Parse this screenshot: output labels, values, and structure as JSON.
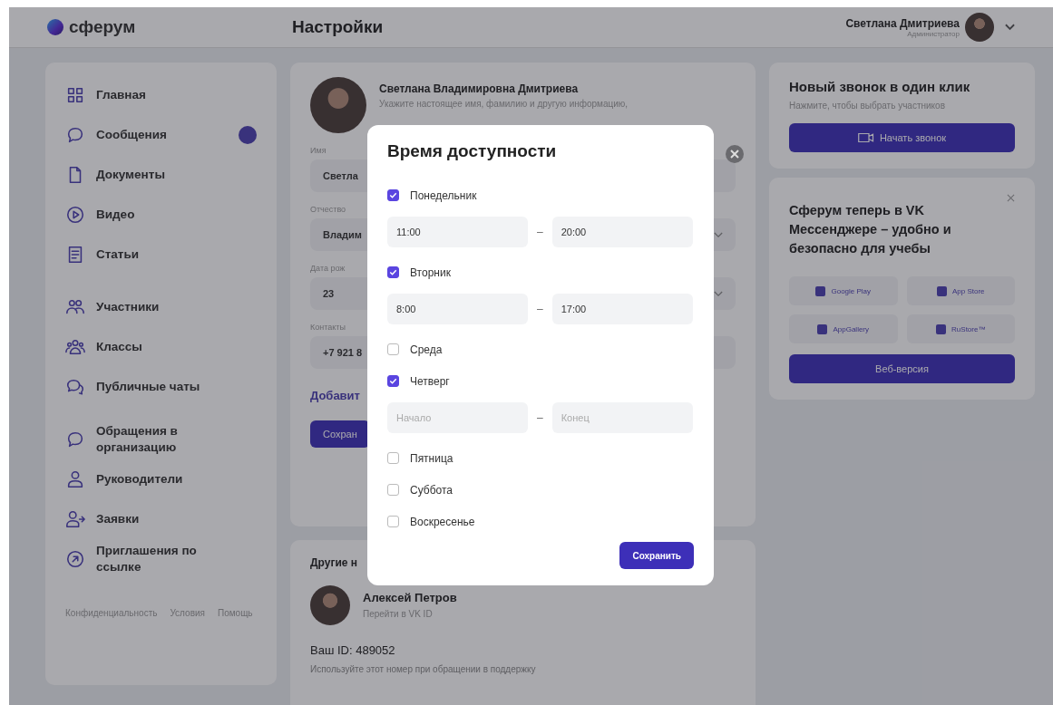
{
  "header": {
    "logo": "сферум",
    "title": "Настройки",
    "user": {
      "name": "Светлана Дмитриева",
      "role": "Администратор"
    }
  },
  "sidebar": {
    "groups": [
      [
        {
          "label": "Главная",
          "badge": false
        },
        {
          "label": "Сообщения",
          "badge": true
        },
        {
          "label": "Документы",
          "badge": false
        },
        {
          "label": "Видео",
          "badge": false
        },
        {
          "label": "Статьи",
          "badge": false
        }
      ],
      [
        {
          "label": "Участники",
          "badge": false
        },
        {
          "label": "Классы",
          "badge": false
        },
        {
          "label": "Публичные чаты",
          "badge": false
        }
      ],
      [
        {
          "label": "Обращения в организацию",
          "badge": false
        },
        {
          "label": "Руководители",
          "badge": false
        },
        {
          "label": "Заявки",
          "badge": false
        },
        {
          "label": "Приглашения по ссылке",
          "badge": false
        }
      ]
    ],
    "footer_links": [
      "Конфиденциальность",
      "Условия",
      "Помощь"
    ]
  },
  "profile": {
    "name": "Светлана Владимировна Дмитриева",
    "hint": "Укажите настоящее имя, фамилию и другую информацию,",
    "fields": [
      {
        "label": "Имя",
        "value": "Светла",
        "dropdown": false
      },
      {
        "label": "Отчество",
        "value": "Владим",
        "dropdown": true
      },
      {
        "label": "Дата рож",
        "value": "23",
        "dropdown": true
      },
      {
        "label": "Контакты",
        "value": "+7 921 8",
        "dropdown": false
      }
    ],
    "add_link": "Добавит",
    "save": "Сохран"
  },
  "accounts": {
    "title": "Другие н",
    "person": {
      "name": "Алексей Петров",
      "link": "Перейти в VK ID"
    },
    "id_text": "Ваш ID: 489052",
    "id_hint": "Используйте этот номер при обращении в поддержку"
  },
  "call_card": {
    "title": "Новый звонок в один клик",
    "text": "Нажмите, чтобы выбрать участников",
    "button": "Начать звонок"
  },
  "promo_card": {
    "title": "Сферум теперь в VK Мессенджере – удобно и безопасно для учебы",
    "stores": [
      "Google Play",
      "App Store",
      "AppGallery",
      "RuStore™"
    ],
    "button": "Веб-версия"
  },
  "modal": {
    "title": "Время доступности",
    "days": [
      {
        "label": "Понедельник",
        "checked": true,
        "start": {
          "value": "11:00"
        },
        "separator": "–",
        "end": {
          "value": "20:00"
        }
      },
      {
        "label": "Вторник",
        "checked": true,
        "start": {
          "value": "8:00"
        },
        "separator": "–",
        "end": {
          "value": "17:00"
        }
      },
      {
        "label": "Среда",
        "checked": false
      },
      {
        "label": "Четверг",
        "checked": true,
        "start": {
          "placeholder": "Начало"
        },
        "separator": "–",
        "end": {
          "placeholder": "Конец"
        }
      },
      {
        "label": "Пятница",
        "checked": false
      },
      {
        "label": "Суббота",
        "checked": false
      },
      {
        "label": "Воскресенье",
        "checked": false
      }
    ],
    "save": "Сохранить"
  }
}
